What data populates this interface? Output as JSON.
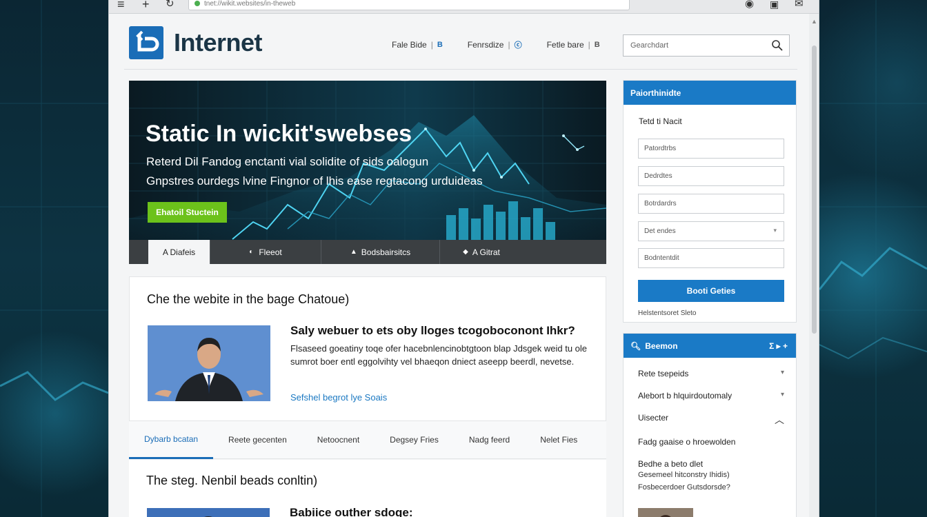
{
  "browser": {
    "url": "tnet://wikit.websites/in-theweb"
  },
  "site": {
    "logo_text": "Internet",
    "nav": [
      {
        "label": "Fale Bide"
      },
      {
        "label": "Fenrsdize"
      },
      {
        "label": "Fetle bare"
      }
    ],
    "search_placeholder": "Gearchdart"
  },
  "hero": {
    "title": "Static In wickit'swebses",
    "subtitle_1": "Reterd Dil Fandog enctanti vial solidite of sids oalogun",
    "subtitle_2": "Gnpstres ourdegs lvine Fingnor of lhis ease regtacong urduideas",
    "button_label": "Ehatoil Stuctein",
    "tabs": [
      {
        "icon": "",
        "label": "A Diafeis"
      },
      {
        "icon": "◐",
        "label": "Fleeot"
      },
      {
        "icon": "▲",
        "label": "Bodsbairsitcs"
      },
      {
        "icon": "◆",
        "label": "A Gitrat"
      }
    ]
  },
  "article": {
    "heading": "Che the webite in the bage Chatoue)",
    "title": "Saly webuer to ets oby lloges tcogoboconont Ihkr?",
    "body": "Flsaseed goeatiny toqe ofer hacebnlencinobtgtoon blap Jdsgek weid tu ole sumrot boer entl eggolvihty vel bhaeqon dniect aseepp beerdl, nevetse.",
    "link": "Sefshel begrot lye Soais"
  },
  "tabs": [
    {
      "label": "Dybarb bcatan"
    },
    {
      "label": "Reete gecenten"
    },
    {
      "label": "Netoocnent"
    },
    {
      "label": "Degsey Fries"
    },
    {
      "label": "Nadg feerd"
    },
    {
      "label": "Nelet Fies"
    }
  ],
  "article2": {
    "heading": "The steg. Nenbil beads conltin)",
    "title": "Babiice outher sdoge:"
  },
  "sidebar_form": {
    "header": "Paiorthinidte",
    "label": "Tetd ti Nacit",
    "fields": [
      {
        "placeholder": "Patordtrbs"
      },
      {
        "placeholder": "Dedrdtes"
      },
      {
        "placeholder": "Botrdardrs"
      },
      {
        "placeholder": "Det endes",
        "dropdown": true
      },
      {
        "placeholder": "Bodntentdit"
      }
    ],
    "button_label": "Booti Geties",
    "note": "Helstentsoret Sleto"
  },
  "sidebar_list": {
    "header": "Beemon",
    "header_icons": "Σ ▸ +",
    "items": [
      {
        "label": "Rete tsepeids",
        "chevron": "▾"
      },
      {
        "label": "Alebort b hlquirdoutomaly",
        "chevron": "▾"
      },
      {
        "label": "Uisecter",
        "chevron": "︿"
      }
    ],
    "sub_title": "Fadg gaaise o hroewolden",
    "sub_heading": "Bedhe a beto dlet",
    "sub_lines": [
      "Gesemeel hitconstry Ihidis)",
      "Fosbecerdoer Gutsdorsde?"
    ]
  },
  "colors": {
    "brand_blue": "#1a7ac6",
    "accent_green": "#6cc21b",
    "hero_bg": "#0b1e28"
  }
}
